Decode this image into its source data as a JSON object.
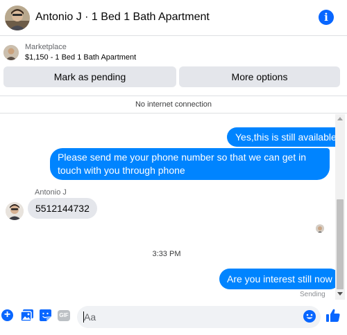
{
  "header": {
    "title": "Antonio J · 1 Bed 1 Bath Apartment",
    "info_icon": "info-icon"
  },
  "listing": {
    "source": "Marketplace",
    "description": "$1,150 - 1 Bed 1 Bath Apartment",
    "buttons": {
      "mark_pending": "Mark as pending",
      "more_options": "More options"
    }
  },
  "status": {
    "connection": "No internet connection"
  },
  "messages": [
    {
      "direction": "out",
      "text": "Yes,this is still available"
    },
    {
      "direction": "out",
      "text": "Please send me your phone  number so that we can get in touch with you through phone"
    },
    {
      "direction": "in",
      "sender": "Antonio J",
      "text": "5512144732"
    },
    {
      "direction": "out",
      "text": "Are you interest still now"
    }
  ],
  "timestamp": "3:33 PM",
  "delivery_status": "Sending",
  "composer": {
    "placeholder": "Aa",
    "icons": [
      "plus-icon",
      "photo-icon",
      "sticker-icon",
      "gif-icon",
      "emoji-icon",
      "like-icon"
    ],
    "gif_label": "GIF"
  },
  "colors": {
    "accent": "#0866ff",
    "outgoing_bubble": "#0084ff",
    "incoming_bubble": "#e4e6eb",
    "button_bg": "#e4e6eb"
  }
}
